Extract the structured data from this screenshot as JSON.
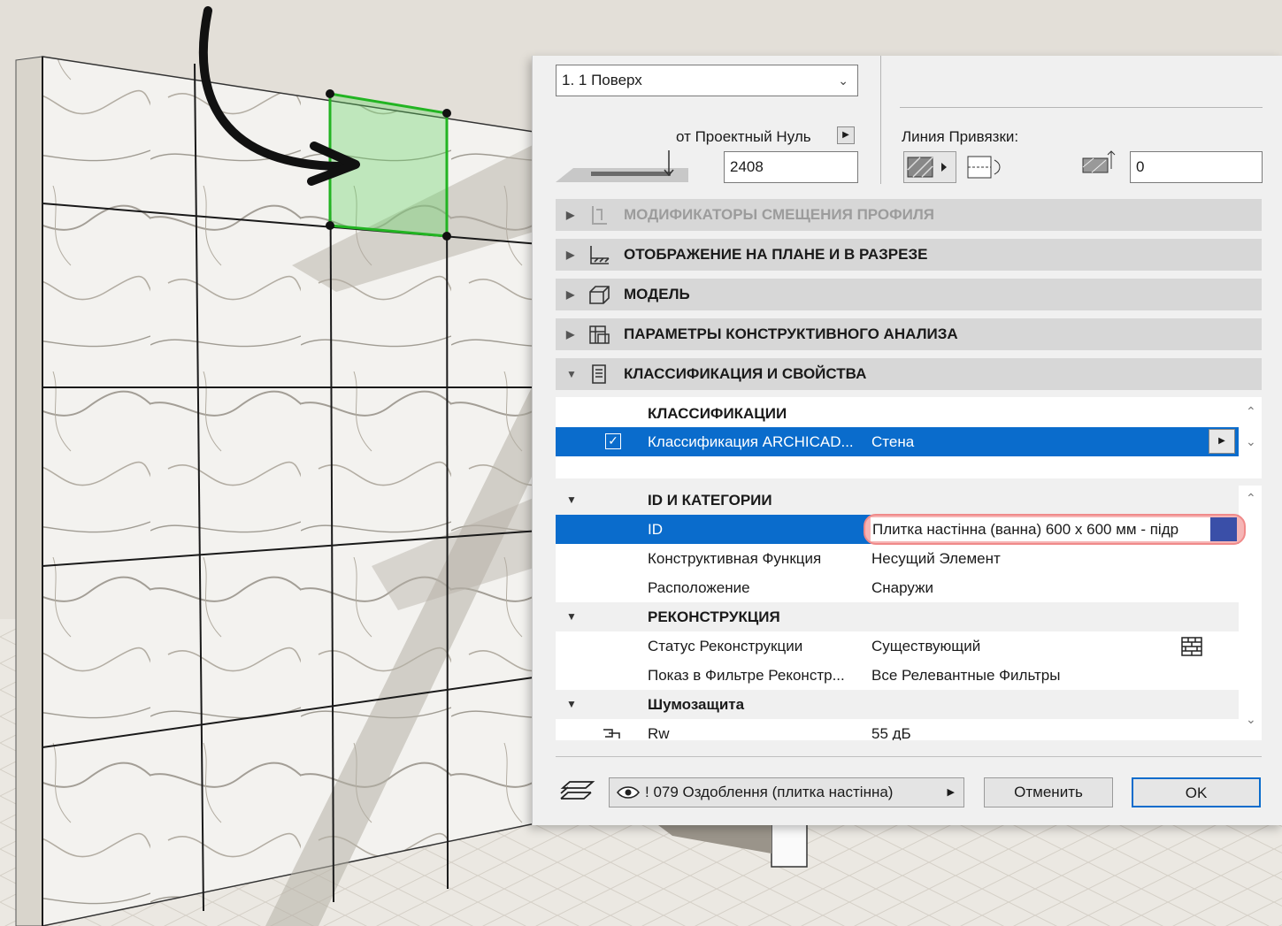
{
  "floor_select": {
    "value": "1. 1 Поверх"
  },
  "elevation": {
    "label": "от Проектный Нуль",
    "value": "2408"
  },
  "reference_line": {
    "label": "Линия Привязки:",
    "offset_value": "0"
  },
  "sections": [
    {
      "label": "МОДИФИКАТОРЫ СМЕЩЕНИЯ ПРОФИЛЯ",
      "icon": "profile-modifier-icon",
      "state": "disabled"
    },
    {
      "label": "ОТОБРАЖЕНИЕ НА ПЛАНЕ И В РАЗРЕЗЕ",
      "icon": "floor-plan-section-icon",
      "state": "collapsed"
    },
    {
      "label": "МОДЕЛЬ",
      "icon": "model-icon",
      "state": "collapsed"
    },
    {
      "label": "ПАРАМЕТРЫ КОНСТРУКТИВНОГО АНАЛИЗА",
      "icon": "structural-analysis-icon",
      "state": "collapsed"
    },
    {
      "label": "КЛАССИФИКАЦИЯ И СВОЙСТВА",
      "icon": "classification-icon",
      "state": "expanded"
    }
  ],
  "classifications": {
    "header": "КЛАССИФИКАЦИИ",
    "row": {
      "name": "Классификация ARCHICAD...",
      "value": "Стена",
      "checked": true
    }
  },
  "properties": {
    "groups": [
      {
        "title": "ID И КАТЕГОРИИ",
        "rows": [
          {
            "name": "ID",
            "value": "Плитка настінна (ванна) 600 x 600 мм - підр",
            "selected": true
          },
          {
            "name": "Конструктивная Функция",
            "value": "Несущий Элемент"
          },
          {
            "name": "Расположение",
            "value": "Снаружи"
          }
        ]
      },
      {
        "title": "РЕКОНСТРУКЦИЯ",
        "rows": [
          {
            "name": "Статус Реконструкции",
            "value": "Существующий",
            "icon": "brick-wall-icon"
          },
          {
            "name": "Показ в Фильтре Реконстр...",
            "value": "Все Релевантные Фильтры"
          }
        ]
      },
      {
        "title": "Шумозащита",
        "rows": [
          {
            "name": "Rw",
            "value": "55 дБ",
            "icon": "acoustic-icon"
          }
        ]
      }
    ]
  },
  "footer": {
    "layer": "! 079 Оздоблення (плитка настінна)",
    "cancel_label": "Отменить",
    "ok_label": "OK"
  },
  "colors": {
    "selection_blue": "#0a6ccc",
    "highlight_red": "#f08a8a",
    "selected_tile_green": "#3fcf3f"
  }
}
